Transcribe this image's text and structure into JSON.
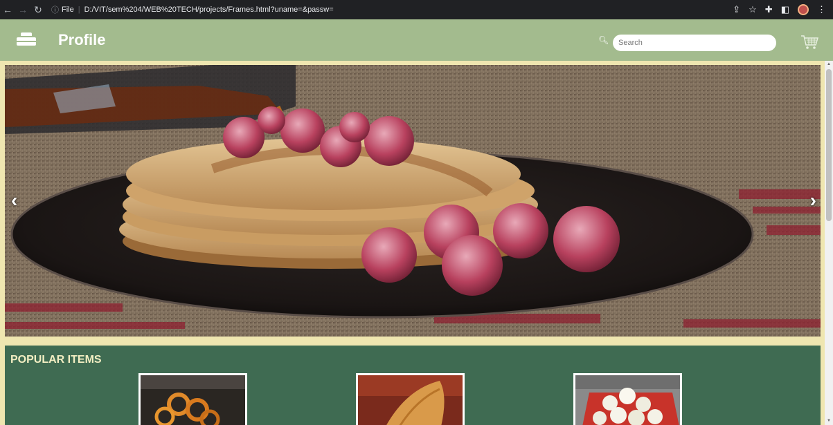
{
  "browser": {
    "file_label": "File",
    "url": "D:/VIT/sem%204/WEB%20TECH/projects/Frames.html?uname=&passw="
  },
  "header": {
    "title": "Profile",
    "search_placeholder": "Search"
  },
  "carousel": {
    "prev_label": "‹",
    "next_label": "›"
  },
  "popular": {
    "heading": "POPULAR ITEMS",
    "items": [
      {
        "icon": "jalebi-image"
      },
      {
        "icon": "dosa-image"
      },
      {
        "icon": "rasgulla-image"
      }
    ]
  }
}
